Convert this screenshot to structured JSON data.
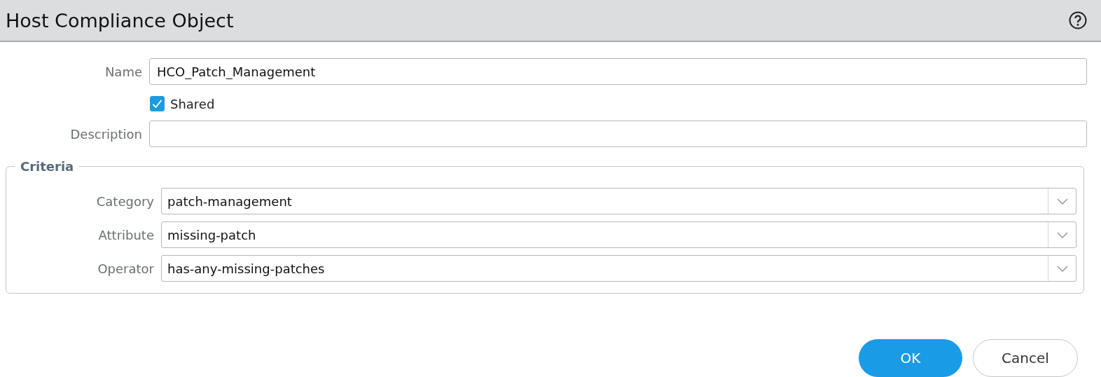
{
  "window": {
    "title": "Host Compliance Object"
  },
  "fields": [
    {
      "label": "Name",
      "value": "HCO_Patch_Management"
    }
  ],
  "shared": {
    "label": "Shared",
    "checked": true
  },
  "description": {
    "label": "Description"
  },
  "criteria": {
    "legend": "Criteria",
    "rows": [
      {
        "label": "Category",
        "value": "patch-management"
      },
      {
        "label": "Attribute",
        "value": "missing-patch"
      },
      {
        "label": "Operator",
        "value": "has-any-missing-patches"
      }
    ]
  },
  "buttons": [
    {
      "label": "OK",
      "kind": "primary"
    },
    {
      "label": "Cancel",
      "kind": "secondary"
    }
  ]
}
